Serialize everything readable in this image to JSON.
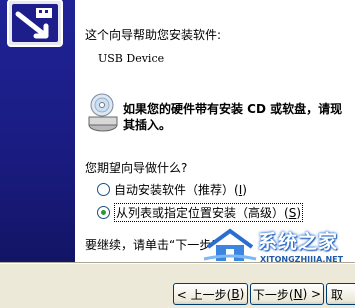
{
  "wizard": {
    "intro": "这个向导帮助您安装软件:",
    "device": "USB Device",
    "note_line1": "如果您的硬件带有安装 CD 或软盘，请现",
    "note_line2": "其插入。",
    "question": "您期望向导做什么?",
    "options": [
      {
        "label": "自动安装软件（推荐）(",
        "key": "I",
        "suffix": ")",
        "selected": false
      },
      {
        "label": "从列表或指定位置安装（高级）(",
        "key": "S",
        "suffix": ")",
        "selected": true
      }
    ],
    "continue_text": "要继续，请单击“下一步”。"
  },
  "buttons": {
    "back_label": "< 上一步(",
    "back_key": "B",
    "back_suffix": ")",
    "next_label": "下一步(",
    "next_key": "N",
    "next_suffix": ") >",
    "cancel_label": "取"
  },
  "watermark": {
    "title": "系统之家",
    "subtitle": "XITONGZHIJIA.NET"
  },
  "colors": {
    "side_panel": "#1d1e8c",
    "radio_dot": "#2a9a2a",
    "button_border": "#003c74"
  }
}
